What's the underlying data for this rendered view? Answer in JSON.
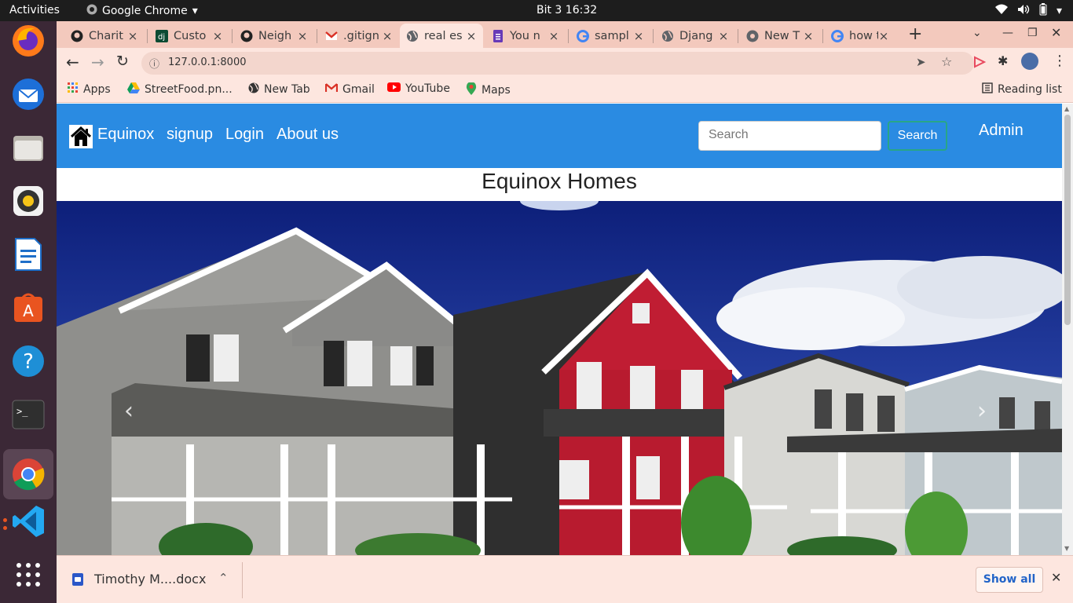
{
  "system": {
    "activities": "Activities",
    "app_name": "Google Chrome",
    "clock": "Bit 3  16:32"
  },
  "tabs": [
    {
      "label": "Charit",
      "icon": "github-icon"
    },
    {
      "label": "Custo",
      "icon": "django-icon"
    },
    {
      "label": "Neigh",
      "icon": "github-icon"
    },
    {
      "label": ".gitign",
      "icon": "gmail-icon"
    },
    {
      "label": "real es",
      "icon": "globe-icon",
      "active": true
    },
    {
      "label": "You n",
      "icon": "forms-icon"
    },
    {
      "label": "sampl",
      "icon": "google-icon"
    },
    {
      "label": "Djang",
      "icon": "globe-icon"
    },
    {
      "label": "New T",
      "icon": "chrome-icon"
    },
    {
      "label": "how t",
      "icon": "google-icon"
    }
  ],
  "address": {
    "url": "127.0.0.1:8000"
  },
  "bookmarks": [
    {
      "label": "Apps",
      "icon": "apps-grid-icon"
    },
    {
      "label": "StreetFood.pn...",
      "icon": "drive-icon"
    },
    {
      "label": "New Tab",
      "icon": "globe-icon"
    },
    {
      "label": "Gmail",
      "icon": "gmail-icon"
    },
    {
      "label": "YouTube",
      "icon": "youtube-icon"
    },
    {
      "label": "Maps",
      "icon": "maps-icon"
    }
  ],
  "reading_list": "Reading list",
  "site": {
    "brand": "Equinox",
    "nav": [
      "signup",
      "Login",
      "About us"
    ],
    "search_placeholder": "Search",
    "search_button": "Search",
    "admin": "Admin",
    "title": "Equinox Homes"
  },
  "download": {
    "filename": "Timothy  M....docx",
    "show_all": "Show all"
  },
  "colors": {
    "navbar": "#2a8be2",
    "search_border": "#28a687",
    "tab_strip": "#f3c9bd",
    "toolbar": "#fde6df",
    "dock": "#3b2836"
  }
}
